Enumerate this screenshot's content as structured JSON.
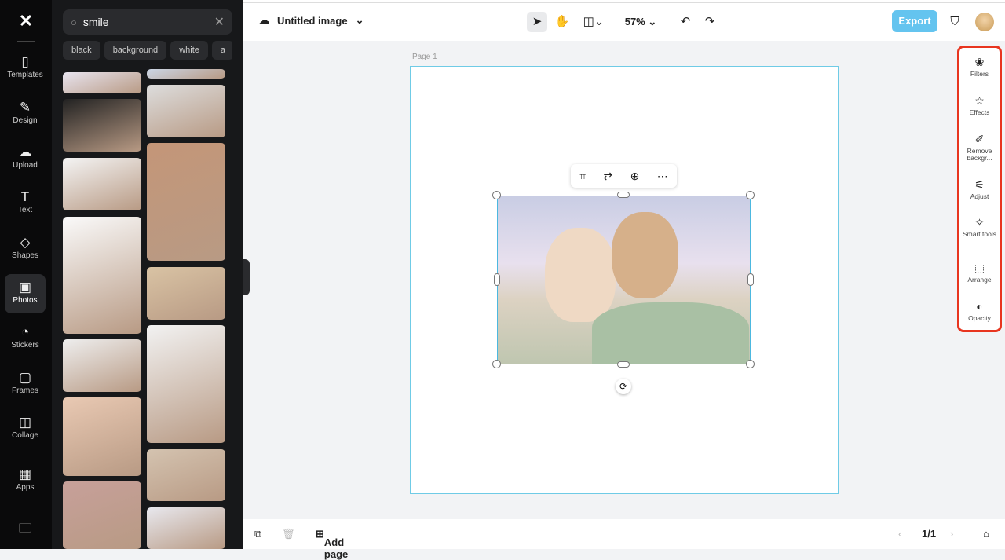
{
  "rail": {
    "items": [
      {
        "label": "Templates",
        "icon": "templates-icon",
        "glyph": "▯"
      },
      {
        "label": "Design",
        "icon": "design-icon",
        "glyph": "✎"
      },
      {
        "label": "Upload",
        "icon": "upload-icon",
        "glyph": "☁"
      },
      {
        "label": "Text",
        "icon": "text-icon",
        "glyph": "T"
      },
      {
        "label": "Shapes",
        "icon": "shapes-icon",
        "glyph": "◇"
      },
      {
        "label": "Photos",
        "icon": "photos-icon",
        "glyph": "▣",
        "active": true
      },
      {
        "label": "Stickers",
        "icon": "stickers-icon",
        "glyph": "◔"
      },
      {
        "label": "Frames",
        "icon": "frames-icon",
        "glyph": "▢"
      },
      {
        "label": "Collage",
        "icon": "collage-icon",
        "glyph": "◫"
      },
      {
        "label": "Apps",
        "icon": "apps-icon",
        "glyph": "▦"
      }
    ]
  },
  "panel": {
    "search_value": "smile",
    "chips": [
      "black",
      "background",
      "white",
      "a"
    ]
  },
  "header": {
    "title": "Untitled image",
    "zoom": "57%",
    "export_label": "Export"
  },
  "canvas": {
    "page_label": "Page 1"
  },
  "right_panel": {
    "items": [
      {
        "label": "Filters",
        "glyph": "❀"
      },
      {
        "label": "Effects",
        "glyph": "☆"
      },
      {
        "label": "Remove backgr...",
        "glyph": "✐"
      },
      {
        "label": "Adjust",
        "glyph": "⚟"
      },
      {
        "label": "Smart tools",
        "glyph": "✧"
      },
      {
        "label": "Arrange",
        "glyph": "⬚"
      },
      {
        "label": "Opacity",
        "glyph": "◐"
      }
    ]
  },
  "bottom": {
    "add_page_label": "Add page",
    "page_count": "1/1"
  },
  "colors": {
    "accent": "#64c4ef",
    "highlight": "#e8351f",
    "selection": "#4cb8e0"
  }
}
